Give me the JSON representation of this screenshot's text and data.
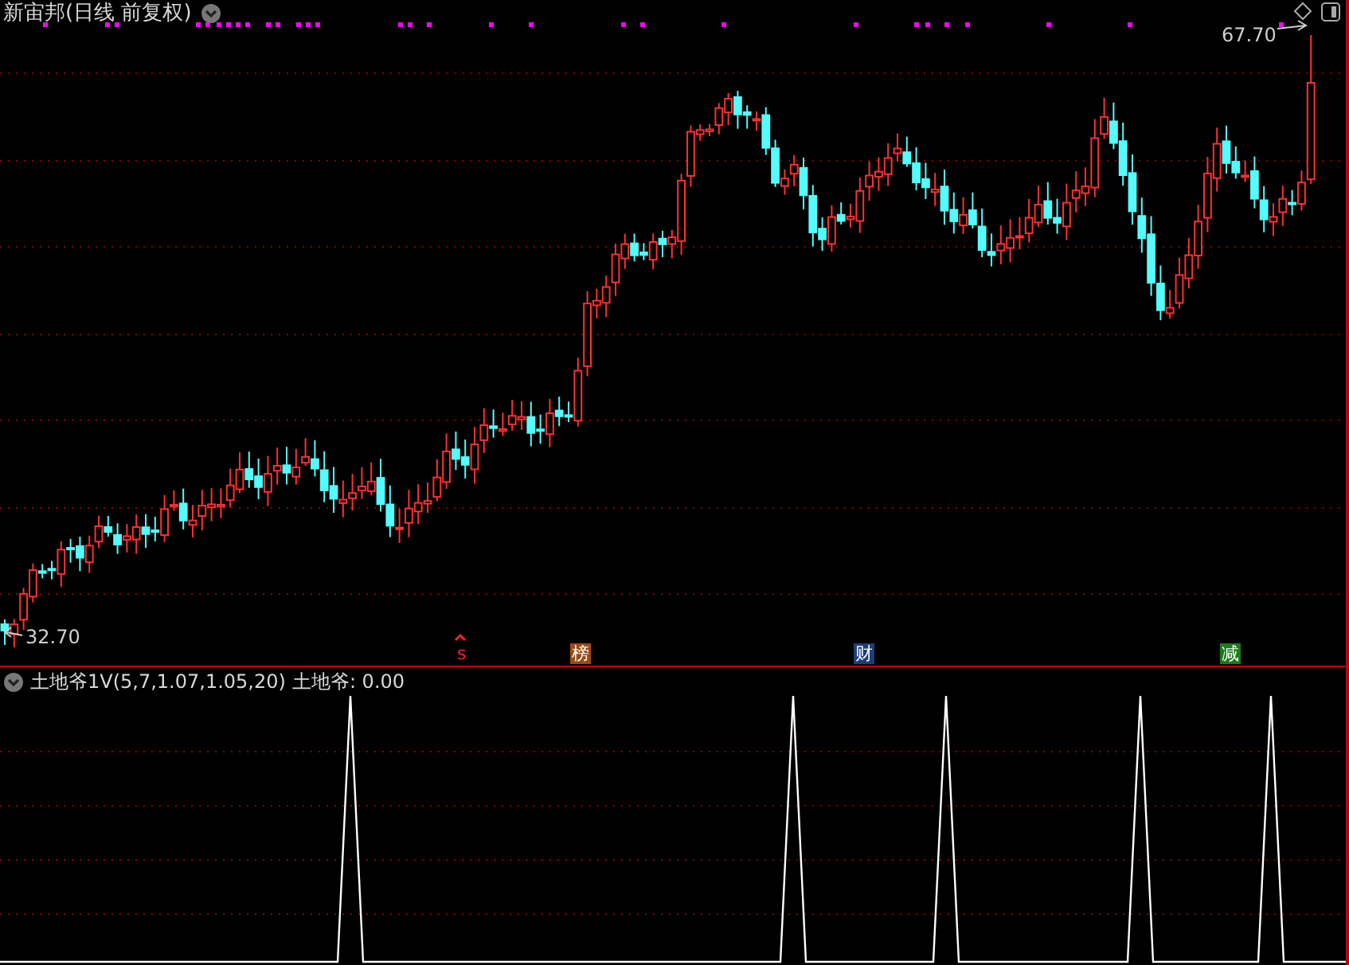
{
  "header": {
    "title": "新宙邦(日线 前复权)"
  },
  "price_labels": [
    {
      "kind": "high",
      "text": "67.70"
    },
    {
      "kind": "low",
      "text": "32.70"
    }
  ],
  "event_markers": [
    {
      "kind": "plain",
      "text": "s",
      "color": "#ff2020"
    },
    {
      "kind": "tag",
      "text": "榜",
      "color": "#9a4a14"
    },
    {
      "kind": "tag",
      "text": "财",
      "color": "#1c3f78"
    },
    {
      "kind": "tag",
      "text": "减",
      "color": "#1d7a1d"
    }
  ],
  "indicator": {
    "name": "土地爷1V(5,7,1.07,1.05,20)",
    "reading": "土地爷: 0.00"
  }
}
